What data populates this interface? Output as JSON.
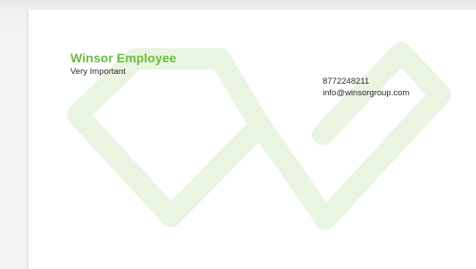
{
  "card": {
    "name": "Winsor Employee",
    "title": "Very Important",
    "phone": "8772248211",
    "email": "info@winsorgroup.com"
  },
  "colors": {
    "accent": "#6cbb3c",
    "watermark": "#e9f5e0",
    "text": "#2a2a2a"
  },
  "icons": {
    "watermark": "winsor-w-logo-icon"
  }
}
